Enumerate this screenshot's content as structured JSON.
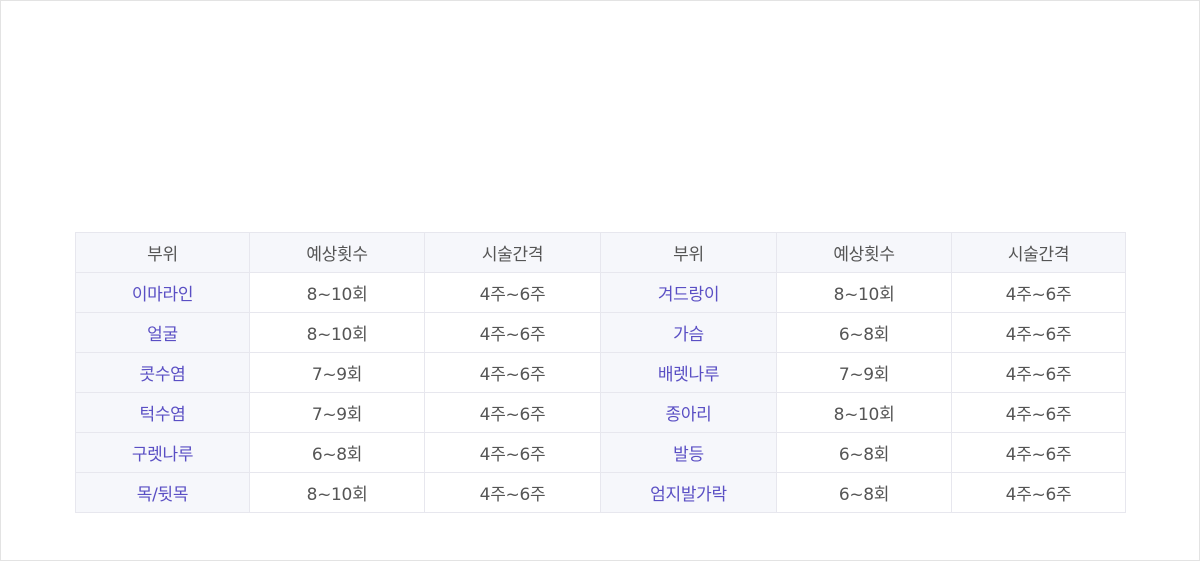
{
  "colors": {
    "part_text": "#5a4fc4",
    "text": "#555555",
    "header_bg": "#f6f7fb",
    "border": "#e7e7ee"
  },
  "table": {
    "headers": [
      "부위",
      "예상횟수",
      "시술간격",
      "부위",
      "예상횟수",
      "시술간격"
    ],
    "rows": [
      {
        "left": {
          "part": "이마라인",
          "count": "8~10회",
          "interval": "4주~6주"
        },
        "right": {
          "part": "겨드랑이",
          "count": "8~10회",
          "interval": "4주~6주"
        }
      },
      {
        "left": {
          "part": "얼굴",
          "count": "8~10회",
          "interval": "4주~6주"
        },
        "right": {
          "part": "가슴",
          "count": "6~8회",
          "interval": "4주~6주"
        }
      },
      {
        "left": {
          "part": "콧수염",
          "count": "7~9회",
          "interval": "4주~6주"
        },
        "right": {
          "part": "배렛나루",
          "count": "7~9회",
          "interval": "4주~6주"
        }
      },
      {
        "left": {
          "part": "턱수염",
          "count": "7~9회",
          "interval": "4주~6주"
        },
        "right": {
          "part": "종아리",
          "count": "8~10회",
          "interval": "4주~6주"
        }
      },
      {
        "left": {
          "part": "구렛나루",
          "count": "6~8회",
          "interval": "4주~6주"
        },
        "right": {
          "part": "발등",
          "count": "6~8회",
          "interval": "4주~6주"
        }
      },
      {
        "left": {
          "part": "목/뒷목",
          "count": "8~10회",
          "interval": "4주~6주"
        },
        "right": {
          "part": "엄지발가락",
          "count": "6~8회",
          "interval": "4주~6주"
        }
      }
    ]
  }
}
